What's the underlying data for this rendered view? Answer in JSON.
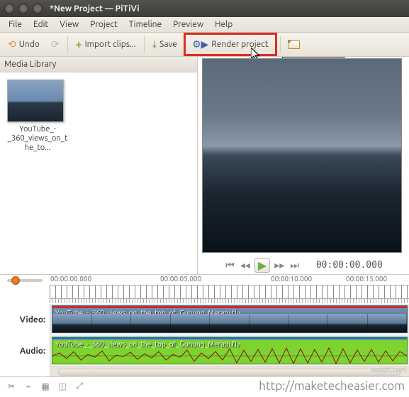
{
  "window": {
    "title": "*New Project — PiTiVi"
  },
  "menu": {
    "file": "File",
    "edit": "Edit",
    "view": "View",
    "project": "Project",
    "timeline": "Timeline",
    "preview": "Preview",
    "help": "Help"
  },
  "toolbar": {
    "undo": "Undo",
    "import": "Import clips...",
    "save": "Save",
    "render": "Render project",
    "tooltip": "Render project"
  },
  "library": {
    "header": "Media Library",
    "items": [
      {
        "label": "YouTube_-_360_views_on_the_to..."
      }
    ]
  },
  "transport": {
    "timecode": "00:00:00.000"
  },
  "timeline": {
    "ticks": [
      "00:00:00.000",
      "00:00:05.000",
      "00:00:10.000",
      "00:00:15.000"
    ],
    "video_label": "Video:",
    "audio_label": "Audio:",
    "clip_title": "YouTube_-_360_views_on_the_top_of_Gunung_Merapi.flv"
  },
  "watermark": {
    "url": "http://maketecheasier.com",
    "side": "wsxdn.com"
  }
}
